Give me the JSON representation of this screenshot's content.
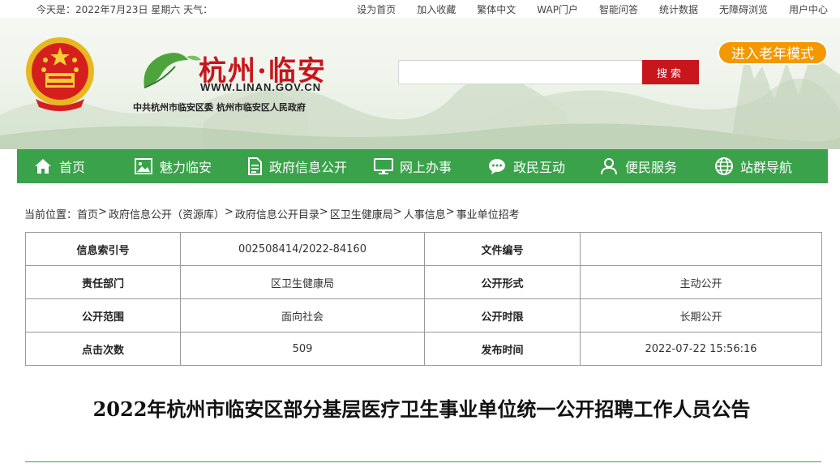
{
  "topbar": {
    "date": "今天是：2022年7月23日 星期六 天气：",
    "links": [
      "设为首页",
      "加入收藏",
      "繁体中文",
      "WAP门户",
      "智能问答",
      "统计数据",
      "无障碍浏览",
      "用户中心"
    ]
  },
  "header": {
    "site_name": "杭州·临安",
    "site_domain": "WWW.LINAN.GOV.CN",
    "site_sub": "中共杭州市临安区委  杭州市临安区人民政府",
    "search_button": "搜索",
    "elder_mode": "进入老年模式"
  },
  "nav": [
    {
      "label": "首页",
      "icon": "home-icon"
    },
    {
      "label": "魅力临安",
      "icon": "image-icon"
    },
    {
      "label": "政府信息公开",
      "icon": "document-icon"
    },
    {
      "label": "网上办事",
      "icon": "monitor-icon"
    },
    {
      "label": "政民互动",
      "icon": "chat-icon"
    },
    {
      "label": "便民服务",
      "icon": "user-icon"
    },
    {
      "label": "站群导航",
      "icon": "globe-icon"
    }
  ],
  "breadcrumb": {
    "prefix": "当前位置：",
    "items": [
      "首页",
      "政府信息公开（资源库）",
      "政府信息公开目录",
      "区卫生健康局",
      "人事信息",
      "事业单位招考"
    ]
  },
  "info_table": {
    "rows": [
      [
        "信息索引号",
        "002508414/2022-84160",
        "文件编号",
        ""
      ],
      [
        "责任部门",
        "区卫生健康局",
        "公开形式",
        "主动公开"
      ],
      [
        "公开范围",
        "面向社会",
        "公开时限",
        "长期公开"
      ],
      [
        "点击次数",
        "509",
        "发布时间",
        "2022-07-22 15:56:16"
      ]
    ]
  },
  "article": {
    "title": "2022年杭州市临安区部分基层医疗卫生事业单位统一公开招聘工作人员公告"
  },
  "colors": {
    "nav_green": "#3aa24a",
    "brand_red": "#c8161d",
    "elder_orange": "#f39800"
  }
}
